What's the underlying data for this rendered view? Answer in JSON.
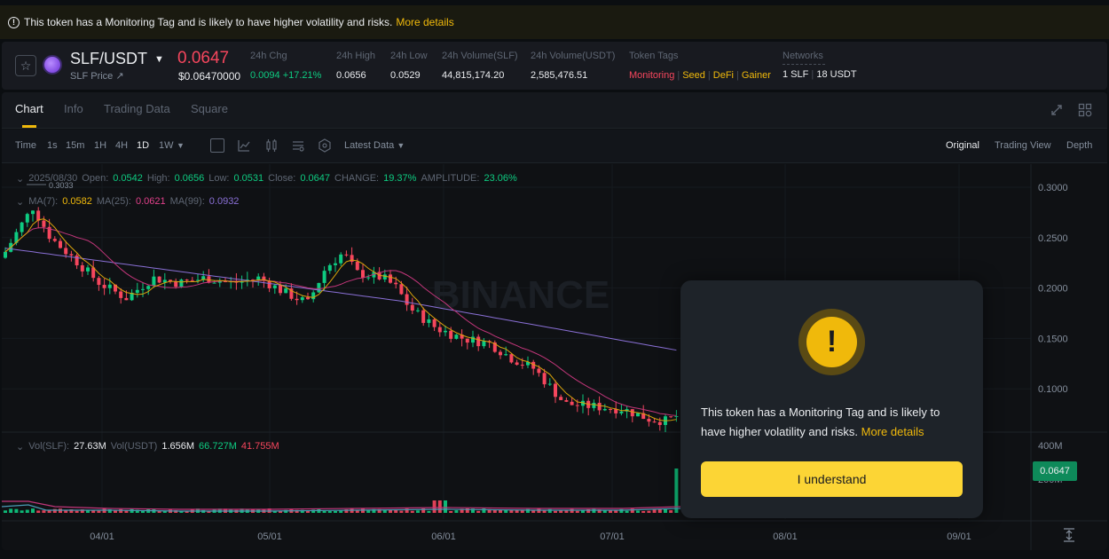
{
  "banner": {
    "text": "This token has a Monitoring Tag and is likely to have higher volatility and risks.",
    "more": "More details"
  },
  "ticker": {
    "pair": "SLF/USDT",
    "sub": "SLF Price ↗",
    "last": "0.0647",
    "usd": "$0.06470000",
    "stats": [
      {
        "label": "24h Chg",
        "value": "0.0094 +17.21%"
      },
      {
        "label": "24h High",
        "value": "0.0656"
      },
      {
        "label": "24h Low",
        "value": "0.0529"
      },
      {
        "label": "24h Volume(SLF)",
        "value": "44,815,174.20"
      },
      {
        "label": "24h Volume(USDT)",
        "value": "2,585,476.51"
      }
    ],
    "tags_label": "Token Tags",
    "tags": [
      "Monitoring",
      "Seed",
      "DeFi",
      "Gainer"
    ],
    "networks_label": "Networks",
    "networks": [
      "1 SLF",
      "18 USDT"
    ]
  },
  "tabs": [
    "Chart",
    "Info",
    "Trading Data",
    "Square"
  ],
  "toolbar": {
    "intervals": [
      "Time",
      "1s",
      "15m",
      "1H",
      "4H",
      "1D",
      "1W"
    ],
    "active_interval": "1D",
    "latest": "Latest Data",
    "views": [
      "Original",
      "Trading View",
      "Depth"
    ]
  },
  "ohlc": {
    "date": "2025/08/30",
    "open_label": "Open:",
    "open": "0.0542",
    "high_label": "High:",
    "high": "0.0656",
    "low_label": "Low:",
    "low": "0.0531",
    "close_label": "Close:",
    "close": "0.0647",
    "change_label": "CHANGE:",
    "change": "19.37%",
    "amp_label": "AMPLITUDE:",
    "amp": "23.06%"
  },
  "ma": {
    "ma7_label": "MA(7):",
    "ma7": "0.0582",
    "ma25_label": "MA(25):",
    "ma25": "0.0621",
    "ma99_label": "MA(99):",
    "ma99": "0.0932"
  },
  "vol": {
    "slf_label": "Vol(SLF):",
    "slf": "27.63M",
    "usdt_label": "Vol(USDT)",
    "usdt": "1.656M",
    "v1": "66.727M",
    "v2": "41.755M"
  },
  "price_axis": [
    "0.3000",
    "0.2500",
    "0.2000",
    "0.1500",
    "0.1000"
  ],
  "vol_axis": [
    "400M",
    "200M"
  ],
  "date_axis": [
    "04/01",
    "05/01",
    "06/01",
    "07/01",
    "08/01",
    "09/01"
  ],
  "high_marker": "0.3033",
  "current_price": "0.0647",
  "watermark": "BINANCE",
  "modal": {
    "message": "This token has a Monitoring Tag and is likely to have higher volatility and risks.",
    "more": "More details",
    "button": "I understand"
  },
  "colors": {
    "accent": "#f0b90b",
    "up": "#0ecb81",
    "down": "#f6465d",
    "ma7": "#f0b90b",
    "ma25": "#e0408a",
    "ma99": "#8a70d6"
  }
}
